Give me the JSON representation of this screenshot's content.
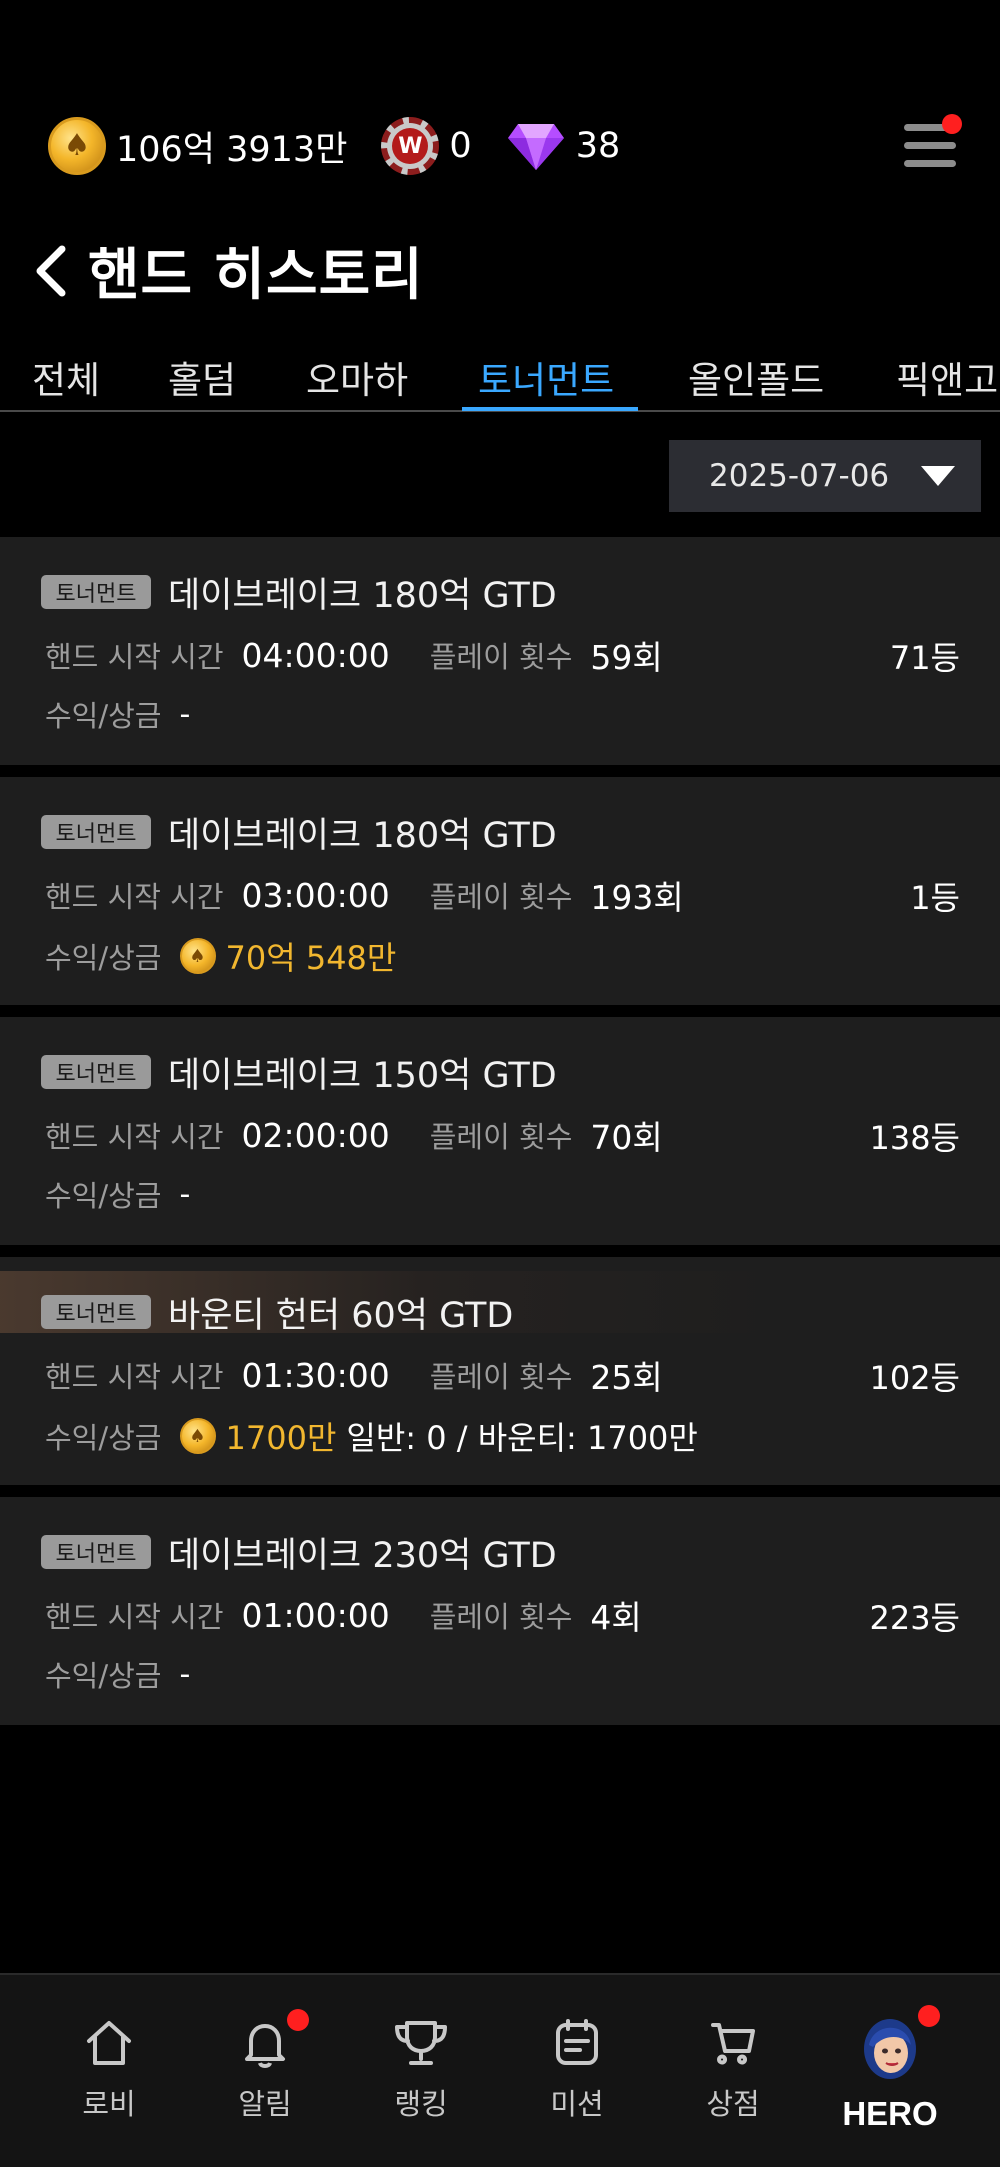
{
  "currency": {
    "gold": "106억 3913만",
    "wchip": "0",
    "gem": "38"
  },
  "page": {
    "title": "핸드 히스토리"
  },
  "tabs": [
    {
      "label": "전체",
      "active": false
    },
    {
      "label": "홀덤",
      "active": false
    },
    {
      "label": "오마하",
      "active": false
    },
    {
      "label": "토너먼트",
      "active": true
    },
    {
      "label": "올인폴드",
      "active": false
    },
    {
      "label": "픽앤고",
      "active": false
    }
  ],
  "date_filter": {
    "value": "2025-07-06"
  },
  "labels": {
    "badge": "토너먼트",
    "start_time": "핸드 시작 시간",
    "play_count": "플레이 횟수",
    "profit": "수익/상금"
  },
  "records": [
    {
      "title": "데이브레이크 180억 GTD",
      "start": "04:00:00",
      "plays": "59회",
      "rank": "71등",
      "prize": "-",
      "prize_amount": "",
      "prize_extra": ""
    },
    {
      "title": "데이브레이크 180억 GTD",
      "start": "03:00:00",
      "plays": "193회",
      "rank": "1등",
      "prize": "",
      "prize_amount": "70억 548만",
      "prize_extra": ""
    },
    {
      "title": "데이브레이크 150억 GTD",
      "start": "02:00:00",
      "plays": "70회",
      "rank": "138등",
      "prize": "-",
      "prize_amount": "",
      "prize_extra": ""
    },
    {
      "title": "바운티 헌터 60억 GTD",
      "start": "01:30:00",
      "plays": "25회",
      "rank": "102등",
      "prize": "",
      "prize_amount": "1700만",
      "prize_extra": "일반: 0 / 바운티: 1700만"
    },
    {
      "title": "데이브레이크 230억 GTD",
      "start": "01:00:00",
      "plays": "4회",
      "rank": "223등",
      "prize": "-",
      "prize_amount": "",
      "prize_extra": ""
    }
  ],
  "nav": [
    {
      "label": "로비",
      "icon": "home-icon"
    },
    {
      "label": "알림",
      "icon": "bell-icon",
      "dot": true
    },
    {
      "label": "랭킹",
      "icon": "trophy-icon"
    },
    {
      "label": "미션",
      "icon": "mission-icon"
    },
    {
      "label": "상점",
      "icon": "cart-icon"
    },
    {
      "label": "HERO",
      "icon": "hero-avatar",
      "dot": true
    }
  ],
  "colors": {
    "accent": "#3aa8ff",
    "gold": "#f2b72f",
    "card": "#1e1e1e",
    "notify": "#ff1f1f"
  }
}
